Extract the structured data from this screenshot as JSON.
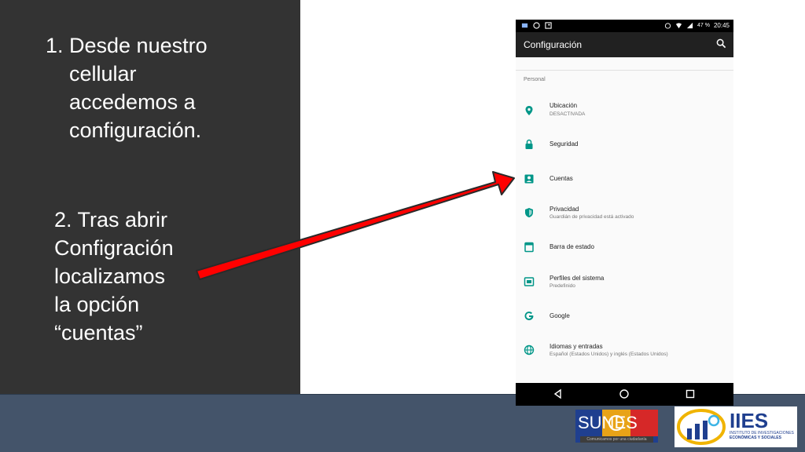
{
  "slide": {
    "step1": {
      "number": "1.",
      "lines": [
        "Desde nuestro",
        "cellular",
        "accedemos a",
        "configuración."
      ]
    },
    "step2": {
      "lines": [
        "2. Tras abrir",
        "Configración",
        "localizamos",
        "la opción",
        "“cuentas”"
      ]
    }
  },
  "phone": {
    "status": {
      "battery": "47 %",
      "time": "20:45",
      "icons": [
        "gallery-icon",
        "whatsapp-icon",
        "photo-icon",
        "alarm-icon",
        "wifi-icon",
        "signal-icon",
        "battery-icon"
      ]
    },
    "appbar": {
      "title": "Configuración",
      "search_icon": "search-icon"
    },
    "section": "Personal",
    "items": [
      {
        "label": "Ubicación",
        "sub": "DESACTIVADA",
        "icon": "location-icon"
      },
      {
        "label": "Seguridad",
        "sub": "",
        "icon": "lock-icon"
      },
      {
        "label": "Cuentas",
        "sub": "",
        "icon": "account-icon"
      },
      {
        "label": "Privacidad",
        "sub": "Guardián de privacidad está activado",
        "icon": "shield-icon"
      },
      {
        "label": "Barra de estado",
        "sub": "",
        "icon": "status-bar-icon"
      },
      {
        "label": "Perfiles del sistema",
        "sub": "Predefinido",
        "icon": "profiles-icon"
      },
      {
        "label": "Google",
        "sub": "",
        "icon": "google-icon"
      },
      {
        "label": "Idiomas y entradas",
        "sub": "Español (Estados Unidos) y inglés (Estados Unidos)",
        "icon": "globe-icon"
      }
    ],
    "nav": [
      "back-icon",
      "home-icon",
      "recents-icon"
    ]
  },
  "colors": {
    "accent": "#009688",
    "dark_panel": "#333333",
    "footer": "#44546a",
    "arrow": "#ff0000"
  },
  "logos": {
    "sunes": {
      "word": "SUNES",
      "tag": "Comunicamos por una ciudadanía"
    },
    "iies": {
      "name": "IIES",
      "line1": "INSTITUTO DE INVESTIGACIONES",
      "line2": "ECONÓMICAS Y SOCIALES"
    }
  }
}
